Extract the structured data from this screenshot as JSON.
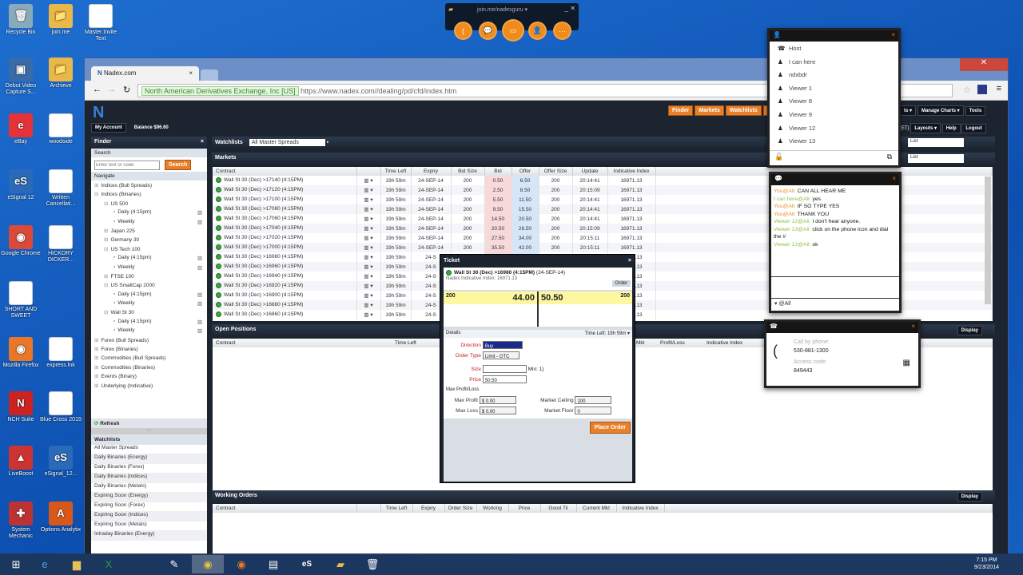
{
  "desktop": {
    "icons": [
      {
        "label": "Recycle Bin",
        "glyph": "🗑",
        "color": "#8ab"
      },
      {
        "label": "join.me",
        "glyph": "📁",
        "color": "#e8b84a"
      },
      {
        "label": "Master Invite Text",
        "glyph": "",
        "color": "#fff"
      },
      {
        "label": "Debut Video Capture S...",
        "glyph": "▣",
        "color": "#3a6aa8"
      },
      {
        "label": "Archieve",
        "glyph": "📁",
        "color": "#e8b84a"
      },
      {
        "label": "eBay",
        "glyph": "e",
        "color": "#e53238"
      },
      {
        "label": "woodside",
        "glyph": "",
        "color": "#fff"
      },
      {
        "label": "eSignal 12",
        "glyph": "eS",
        "color": "#2a6ab8"
      },
      {
        "label": "Written Cancellati...",
        "glyph": "",
        "color": "#fff"
      },
      {
        "label": "Google Chrome",
        "glyph": "◉",
        "color": "#d94a3a"
      },
      {
        "label": "HICKORY DICKER...",
        "glyph": "",
        "color": "#fff"
      },
      {
        "label": "SHORT AND SWEET",
        "glyph": "",
        "color": "#fff"
      },
      {
        "label": "Mozilla Firefox",
        "glyph": "◉",
        "color": "#e8772a"
      },
      {
        "label": "express.lnk",
        "glyph": "",
        "color": "#fff"
      },
      {
        "label": "NCH Suite",
        "glyph": "N",
        "color": "#c22"
      },
      {
        "label": "Blue Cross 2015",
        "glyph": "",
        "color": "#fff"
      },
      {
        "label": "LiveBoost",
        "glyph": "▲",
        "color": "#c33"
      },
      {
        "label": "eSignal_12...",
        "glyph": "eS",
        "color": "#2a6ab8"
      },
      {
        "label": "System Mechanic",
        "glyph": "✚",
        "color": "#b33"
      },
      {
        "label": "Options Analytix",
        "glyph": "A",
        "color": "#d8581c"
      }
    ]
  },
  "joinme": {
    "title": "join.me/nadexguru ▾",
    "buttons": [
      "phone",
      "chat",
      "screen",
      "people",
      "more"
    ]
  },
  "browser": {
    "tab_title": "Nadex.com",
    "ev_label": "North American Derivatives Exchange, Inc [US]",
    "url": "https://www.nadex.com//dealing/pd/cfd/index.htm"
  },
  "nadex": {
    "logo": "N",
    "top_buttons": [
      "Finder",
      "Markets",
      "Watchlists",
      "Open"
    ],
    "right_buttons": [
      "Manage Charts ▾",
      "Tools"
    ],
    "right_buttons_partial": "ts ▾",
    "account": "My Account",
    "balance": "Balance $96.60",
    "sub_buttons": [
      "Layouts ▾",
      "Help",
      "Logout"
    ],
    "tz": "(ET)",
    "list1": "List",
    "list2": "List",
    "finder": {
      "title": "Finder",
      "search_header": "Search",
      "search_placeholder": "Enter text or code",
      "search_button": "Search",
      "navigate": "Navigate",
      "tree": [
        {
          "t": "Indices (Bull Spreads)",
          "l": 0,
          "s": "⊞"
        },
        {
          "t": "Indices (Binaries)",
          "l": 0,
          "s": "⊟"
        },
        {
          "t": "US 500",
          "l": 1,
          "s": "⊟"
        },
        {
          "t": "Daily (4:15pm)",
          "l": 2,
          "s": "▪",
          "c": 1
        },
        {
          "t": "Weekly",
          "l": 2,
          "s": "▪",
          "c": 1
        },
        {
          "t": "Japan 225",
          "l": 1,
          "s": "⊞"
        },
        {
          "t": "Germany 30",
          "l": 1,
          "s": "⊞"
        },
        {
          "t": "US Tech 100",
          "l": 1,
          "s": "⊟"
        },
        {
          "t": "Daily (4:15pm)",
          "l": 2,
          "s": "▪",
          "c": 1
        },
        {
          "t": "Weekly",
          "l": 2,
          "s": "▪",
          "c": 1
        },
        {
          "t": "FTSE 100",
          "l": 1,
          "s": "⊞"
        },
        {
          "t": "US SmallCap 2000",
          "l": 1,
          "s": "⊟"
        },
        {
          "t": "Daily (4:15pm)",
          "l": 2,
          "s": "▪",
          "c": 1
        },
        {
          "t": "Weekly",
          "l": 2,
          "s": "▪",
          "c": 1
        },
        {
          "t": "Wall St 30",
          "l": 1,
          "s": "⊟"
        },
        {
          "t": "Daily (4:15pm)",
          "l": 2,
          "s": "▪",
          "c": 1
        },
        {
          "t": "Weekly",
          "l": 2,
          "s": "▪",
          "c": 1
        },
        {
          "t": "Forex (Bull Spreads)",
          "l": 0,
          "s": "⊞"
        },
        {
          "t": "Forex (Binaries)",
          "l": 0,
          "s": "⊞"
        },
        {
          "t": "Commodities (Bull Spreads)",
          "l": 0,
          "s": "⊞"
        },
        {
          "t": "Commodities (Binaries)",
          "l": 0,
          "s": "⊞"
        },
        {
          "t": "Events (Binary)",
          "l": 0,
          "s": "⊞"
        },
        {
          "t": "Underlying (Indicative)",
          "l": 0,
          "s": "⊞"
        }
      ],
      "refresh": "Refresh",
      "watchlists_header": "Watchlists",
      "watchlists": [
        "All Master Spreads",
        "Daily Binaries (Energy)",
        "Daily Binaries (Forex)",
        "Daily Binaries (Indices)",
        "Daily Binaries (Metals)",
        "Expiring Soon (Energy)",
        "Expiring Soon (Forex)",
        "Expiring Soon (Indices)",
        "Expiring Soon (Metals)",
        "Intraday Binaries (Energy)"
      ]
    },
    "watchlists_label": "Watchlists",
    "watchlist_value": "All Master Spreads",
    "markets": {
      "title": "Markets",
      "columns": [
        "Contract",
        "",
        "Time Left",
        "Expiry",
        "Bid Size",
        "Bid",
        "Offer",
        "Offer Size",
        "Update",
        "Indicative Index"
      ],
      "rows": [
        {
          "contract": "Wall St 30 (Dec) >17140 (4:15PM)",
          "time": "19h 59m",
          "expiry": "24-SEP-14",
          "bid_size": "200",
          "bid": "0.50",
          "offer": "6.50",
          "offer_size": "200",
          "update": "20:14:41",
          "index": "16971.13"
        },
        {
          "contract": "Wall St 30 (Dec) >17120 (4:15PM)",
          "time": "19h 59m",
          "expiry": "24-SEP-14",
          "bid_size": "200",
          "bid": "2.50",
          "offer": "8.50",
          "offer_size": "200",
          "update": "20:15:09",
          "index": "16971.13"
        },
        {
          "contract": "Wall St 30 (Dec) >17100 (4:15PM)",
          "time": "19h 59m",
          "expiry": "24-SEP-14",
          "bid_size": "200",
          "bid": "5.50",
          "offer": "11.50",
          "offer_size": "200",
          "update": "20:14:41",
          "index": "16971.13"
        },
        {
          "contract": "Wall St 30 (Dec) >17080 (4:15PM)",
          "time": "19h 59m",
          "expiry": "24-SEP-14",
          "bid_size": "200",
          "bid": "9.50",
          "offer": "15.50",
          "offer_size": "200",
          "update": "20:14:41",
          "index": "16971.13"
        },
        {
          "contract": "Wall St 30 (Dec) >17060 (4:15PM)",
          "time": "19h 59m",
          "expiry": "24-SEP-14",
          "bid_size": "200",
          "bid": "14.50",
          "offer": "20.50",
          "offer_size": "200",
          "update": "20:14:41",
          "index": "16971.13"
        },
        {
          "contract": "Wall St 30 (Dec) >17040 (4:15PM)",
          "time": "19h 59m",
          "expiry": "24-SEP-14",
          "bid_size": "200",
          "bid": "20.50",
          "offer": "26.50",
          "offer_size": "200",
          "update": "20:15:09",
          "index": "16971.13"
        },
        {
          "contract": "Wall St 30 (Dec) >17020 (4:15PM)",
          "time": "19h 59m",
          "expiry": "24-SEP-14",
          "bid_size": "200",
          "bid": "27.50",
          "offer": "34.00",
          "offer_size": "200",
          "update": "20:15:11",
          "index": "16971.13"
        },
        {
          "contract": "Wall St 30 (Dec) >17000 (4:15PM)",
          "time": "19h 59m",
          "expiry": "24-SEP-14",
          "bid_size": "200",
          "bid": "35.50",
          "offer": "42.00",
          "offer_size": "200",
          "update": "20:15:11",
          "index": "16971.13"
        },
        {
          "contract": "Wall St 30 (Dec) >16980 (4:15PM)",
          "time": "19h 59m",
          "expiry": "24-S",
          "bid_size": "",
          "bid": "",
          "offer": "",
          "offer_size": "",
          "update": "",
          "index": "16971.13"
        },
        {
          "contract": "Wall St 30 (Dec) >16960 (4:15PM)",
          "time": "19h 59m",
          "expiry": "24-S",
          "bid_size": "",
          "bid": "",
          "offer": "",
          "offer_size": "",
          "update": "",
          "index": "16971.13"
        },
        {
          "contract": "Wall St 30 (Dec) >16940 (4:15PM)",
          "time": "19h 59m",
          "expiry": "24-S",
          "bid_size": "",
          "bid": "",
          "offer": "",
          "offer_size": "",
          "update": "",
          "index": "16971.13"
        },
        {
          "contract": "Wall St 30 (Dec) >16920 (4:15PM)",
          "time": "19h 59m",
          "expiry": "24-S",
          "bid_size": "",
          "bid": "",
          "offer": "",
          "offer_size": "",
          "update": "",
          "index": "16971.13"
        },
        {
          "contract": "Wall St 30 (Dec) >16900 (4:15PM)",
          "time": "19h 59m",
          "expiry": "24-S",
          "bid_size": "",
          "bid": "",
          "offer": "",
          "offer_size": "",
          "update": "",
          "index": "16971.13"
        },
        {
          "contract": "Wall St 30 (Dec) >16880 (4:15PM)",
          "time": "19h 59m",
          "expiry": "24-S",
          "bid_size": "",
          "bid": "",
          "offer": "",
          "offer_size": "",
          "update": "",
          "index": "16971.13"
        },
        {
          "contract": "Wall St 30 (Dec) >16860 (4:15PM)",
          "time": "19h 59m",
          "expiry": "24-S",
          "bid_size": "",
          "bid": "",
          "offer": "",
          "offer_size": "",
          "update": "",
          "index": "16971.13"
        }
      ]
    },
    "open_positions": {
      "title": "Open Positions",
      "display": "Display",
      "columns_left": [
        "Contract",
        "Time Left"
      ],
      "columns_right": [
        "Mkt",
        "Profit/Loss",
        "Indicative Index"
      ]
    },
    "working_orders": {
      "title": "Working Orders",
      "display": "Display",
      "columns": [
        "Contract",
        "",
        "Time Left",
        "Expiry",
        "Order Size",
        "Working",
        "Price",
        "Good Til",
        "Current Mkt",
        "Indicative Index"
      ]
    },
    "ticket": {
      "title": "Ticket",
      "contract": "Wall St 30 (Dec) >16980 (4:15PM)",
      "date": "(24-SEP-14)",
      "indicative": "Nadex Indicative Index: 16971.13",
      "order_tab": "Order",
      "sell_size": "200",
      "sell_price": "44.00",
      "buy_price": "50.50",
      "buy_size": "200",
      "details": "Details",
      "time_left": "Time Left: 19h 59m",
      "direction_label": "Direction",
      "direction": "Buy",
      "order_type_label": "Order Type",
      "order_type": "Limit - GTC",
      "size_label": "Size",
      "size": "",
      "min": "Min: 1)",
      "price_label": "Price",
      "price": "50.50",
      "mpl": "Max Profit/Loss",
      "max_profit_label": "Max Profit",
      "max_profit": "$ 0.00",
      "max_loss_label": "Max Loss",
      "max_loss": "$ 0.00",
      "ceiling_label": "Market Ceiling",
      "ceiling": "100",
      "floor_label": "Market Floor",
      "floor": "0",
      "place": "Place Order"
    }
  },
  "participants": {
    "items": [
      "Host",
      "I can here",
      "ndxbdr",
      "Viewer 1",
      "Viewer 8",
      "Viewer 9",
      "Viewer 12",
      "Viewer 13"
    ]
  },
  "chat": {
    "messages": [
      {
        "from": "You@All:",
        "text": "CAN ALL HEAR ME",
        "c": "o"
      },
      {
        "from": "I can here@All:",
        "text": "yes",
        "c": "gr"
      },
      {
        "from": "You@All:",
        "text": "IF SO TYPE YES",
        "c": "o"
      },
      {
        "from": "You@All:",
        "text": "THANK YOU",
        "c": "o"
      },
      {
        "from": "Viewer 12@All:",
        "text": "I don't hear anyone.",
        "c": "gr"
      },
      {
        "from": "Viewer 13@All:",
        "text": "click on the phone icon and dial the #",
        "c": "gr"
      },
      {
        "from": "Viewer 12@All:",
        "text": "ok",
        "c": "gr"
      }
    ],
    "to": "▾ @All"
  },
  "phone": {
    "call_label": "Call by phone:",
    "number": "530-881-1300",
    "access_label": "Access code:",
    "code": "849443"
  },
  "taskbar": {
    "time": "7:15 PM",
    "date": "9/23/2014"
  }
}
